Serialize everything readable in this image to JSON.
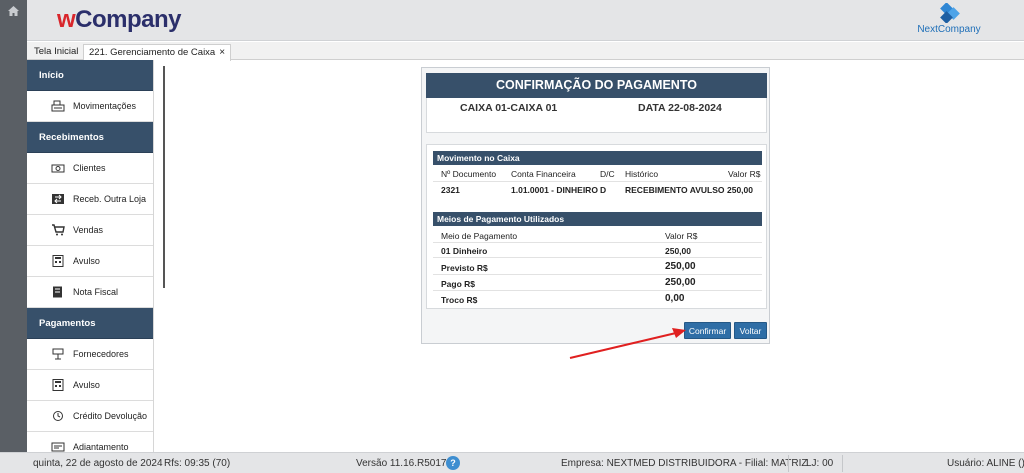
{
  "header": {
    "brand_prefix": "w",
    "brand_rest": "Company",
    "partner_logo_text": "NextCompany"
  },
  "tabs": {
    "home": "Tela Inicial",
    "active": "221. Gerenciamento de Caixa",
    "close": "×"
  },
  "sidebar": {
    "sections": [
      {
        "title": "Início",
        "items": [
          {
            "label": "Movimentações",
            "icon": "cash-register-icon"
          }
        ]
      },
      {
        "title": "Recebimentos",
        "items": [
          {
            "label": "Clientes",
            "icon": "money-icon"
          },
          {
            "label": "Receb. Outra Loja",
            "icon": "transfer-icon"
          },
          {
            "label": "Vendas",
            "icon": "cart-icon"
          },
          {
            "label": "Avulso",
            "icon": "calculator-icon"
          },
          {
            "label": "Nota Fiscal",
            "icon": "invoice-icon"
          }
        ]
      },
      {
        "title": "Pagamentos",
        "items": [
          {
            "label": "Fornecedores",
            "icon": "supplier-icon"
          },
          {
            "label": "Avulso",
            "icon": "calculator-icon"
          },
          {
            "label": "Crédito Devolução",
            "icon": "refund-icon"
          },
          {
            "label": "Adiantamento",
            "icon": "advance-icon"
          }
        ]
      }
    ]
  },
  "dialog": {
    "title": "CONFIRMAÇÃO DO PAGAMENTO",
    "caixa": "CAIXA  01-CAIXA 01",
    "data": "DATA  22-08-2024",
    "movimento": {
      "heading": "Movimento no Caixa",
      "columns": [
        "Nº Documento",
        "Conta Financeira",
        "D/C",
        "Histórico",
        "Valor R$"
      ],
      "row": [
        "2321",
        "1.01.0001 - DINHEIRO",
        "D",
        "RECEBIMENTO AVULSO",
        "250,00"
      ]
    },
    "meios": {
      "heading": "Meios de Pagamento Utilizados",
      "col_meio": "Meio de Pagamento",
      "col_valor": "Valor R$",
      "meio_nome": "01 Dinheiro",
      "meio_valor": "250,00",
      "previsto_label": "Previsto R$",
      "previsto_valor": "250,00",
      "pago_label": "Pago R$",
      "pago_valor": "250,00",
      "troco_label": "Troco R$",
      "troco_valor": "0,00"
    },
    "buttons": {
      "confirm": "Confirmar",
      "back": "Voltar"
    }
  },
  "footer": {
    "date": "quinta, 22 de agosto de 2024",
    "rfs": "Rfs: 09:35 (70)",
    "version": "Versão 11.16.R5017",
    "help": "?",
    "empresa": "Empresa: NEXTMED DISTRIBUIDORA - Filial: MATRIZ",
    "loja": "LJ: 00",
    "usuario": "Usuário: ALINE ()"
  },
  "colors": {
    "navy": "#37506a",
    "button": "#2f6ea6",
    "brand_red": "#d9262c",
    "brand_navy": "#2b2f6b",
    "arrow": "#e02020"
  }
}
